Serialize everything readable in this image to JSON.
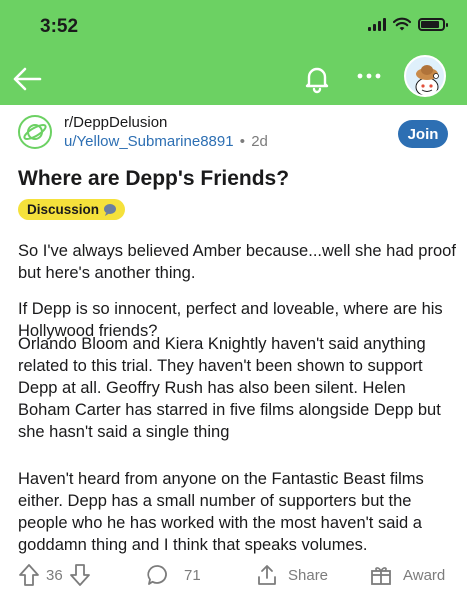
{
  "status_bar": {
    "time": "3:52",
    "battery_level": 0.85
  },
  "nav": {
    "back_icon": "arrow-left-icon",
    "bell_icon": "bell-icon",
    "more_icon": "more-horizontal-icon",
    "avatar_icon": "user-avatar-icon"
  },
  "post": {
    "subreddit": "r/DeppDelusion",
    "username": "u/Yellow_Submarine8891",
    "separator": "•",
    "age": "2d",
    "join_label": "Join",
    "title": "Where are Depp's Friends?",
    "flair": "Discussion",
    "flair_icon": "speech-bubble-icon",
    "paragraphs": [
      "So I've always believed Amber because...well she had proof but here's another thing.",
      "If Depp is so innocent, perfect and loveable, where are his Hollywood friends?",
      "Orlando Bloom and Kiera Knightly haven't said anything related to this trial. They haven't been shown to support Depp at all. Geoffry Rush has also been silent. Helen Boham Carter has starred in five films alongside Depp but she hasn't said a single thing",
      "Haven't heard from anyone on the Fantastic Beast films either. Depp has a small number of supporters but the people who he has worked with the most haven't said a goddamn thing and I think that speaks volumes."
    ]
  },
  "actions": {
    "votes": "36",
    "comments": "71",
    "share_label": "Share",
    "award_label": "Award"
  },
  "colors": {
    "header_bg": "#6cd163",
    "accent_blue": "#2d6fb3",
    "flair_bg": "#f5e13b",
    "meta_gray": "#7c7c7c"
  }
}
